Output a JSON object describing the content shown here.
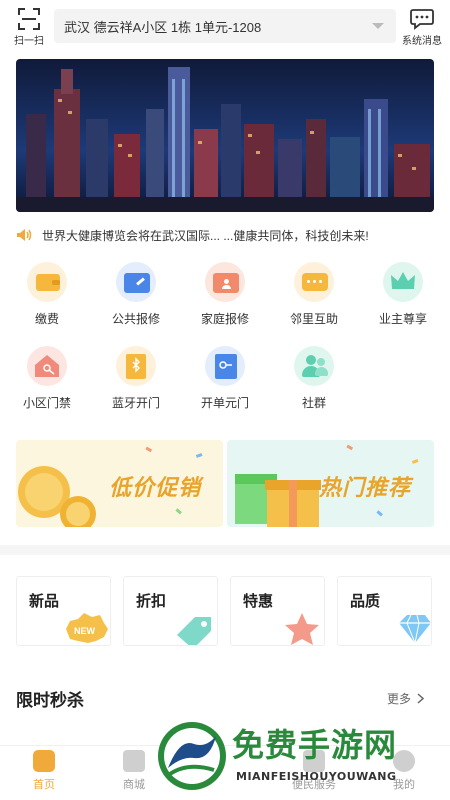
{
  "topbar": {
    "scan_label": "扫一扫",
    "address": "武汉 德云祥A小区 1栋 1单元-1208",
    "message_label": "系统消息"
  },
  "notice": {
    "text": "世界大健康博览会将在武汉国际... ...健康共同体，科技创未来!"
  },
  "functions": [
    {
      "label": "缴费",
      "icon": "wallet-icon",
      "color": "#f5b83d",
      "bg": "#fdf1dc"
    },
    {
      "label": "公共报修",
      "icon": "folder-wrench-icon",
      "color": "#4a86e8",
      "bg": "#e3edfc"
    },
    {
      "label": "家庭报修",
      "icon": "folder-person-icon",
      "color": "#f08a6a",
      "bg": "#fde6de"
    },
    {
      "label": "邻里互助",
      "icon": "chat-bubble-icon",
      "color": "#f5b83d",
      "bg": "#fdf1dc"
    },
    {
      "label": "业主尊享",
      "icon": "crown-icon",
      "color": "#5ccfb0",
      "bg": "#dff6ef"
    },
    {
      "label": "小区门禁",
      "icon": "house-key-icon",
      "color": "#f08a7a",
      "bg": "#fde6e2"
    },
    {
      "label": "蓝牙开门",
      "icon": "bluetooth-door-icon",
      "color": "#f5b83d",
      "bg": "#fdf1dc"
    },
    {
      "label": "开单元门",
      "icon": "unit-door-key-icon",
      "color": "#4a86e8",
      "bg": "#e3edfc"
    },
    {
      "label": "社群",
      "icon": "community-icon",
      "color": "#5ccfb0",
      "bg": "#dff6ef"
    }
  ],
  "promos": [
    {
      "text": "低价促销",
      "icon": "coins-icon"
    },
    {
      "text": "热门推荐",
      "icon": "gift-icon"
    }
  ],
  "categories": [
    {
      "label": "新品",
      "icon": "new-badge-icon",
      "badge": "NEW"
    },
    {
      "label": "折扣",
      "icon": "price-tag-icon"
    },
    {
      "label": "特惠",
      "icon": "star-icon"
    },
    {
      "label": "品质",
      "icon": "diamond-icon"
    }
  ],
  "flash_sale": {
    "title": "限时秒杀",
    "more": "更多"
  },
  "tabbar": [
    {
      "label": "首页",
      "icon": "home-icon",
      "active": true
    },
    {
      "label": "商城",
      "icon": "shop-icon",
      "active": false
    },
    {
      "label": "便民服务",
      "icon": "service-icon",
      "active": false
    },
    {
      "label": "我的",
      "icon": "profile-icon",
      "active": false
    }
  ],
  "watermark": {
    "title": "免费手游网",
    "subtitle": "MIANFEISHOUYOUWANG"
  },
  "colors": {
    "accent": "#f2a93b",
    "promo_text": "#e8a42b",
    "watermark_green": "#2a8a3c"
  }
}
